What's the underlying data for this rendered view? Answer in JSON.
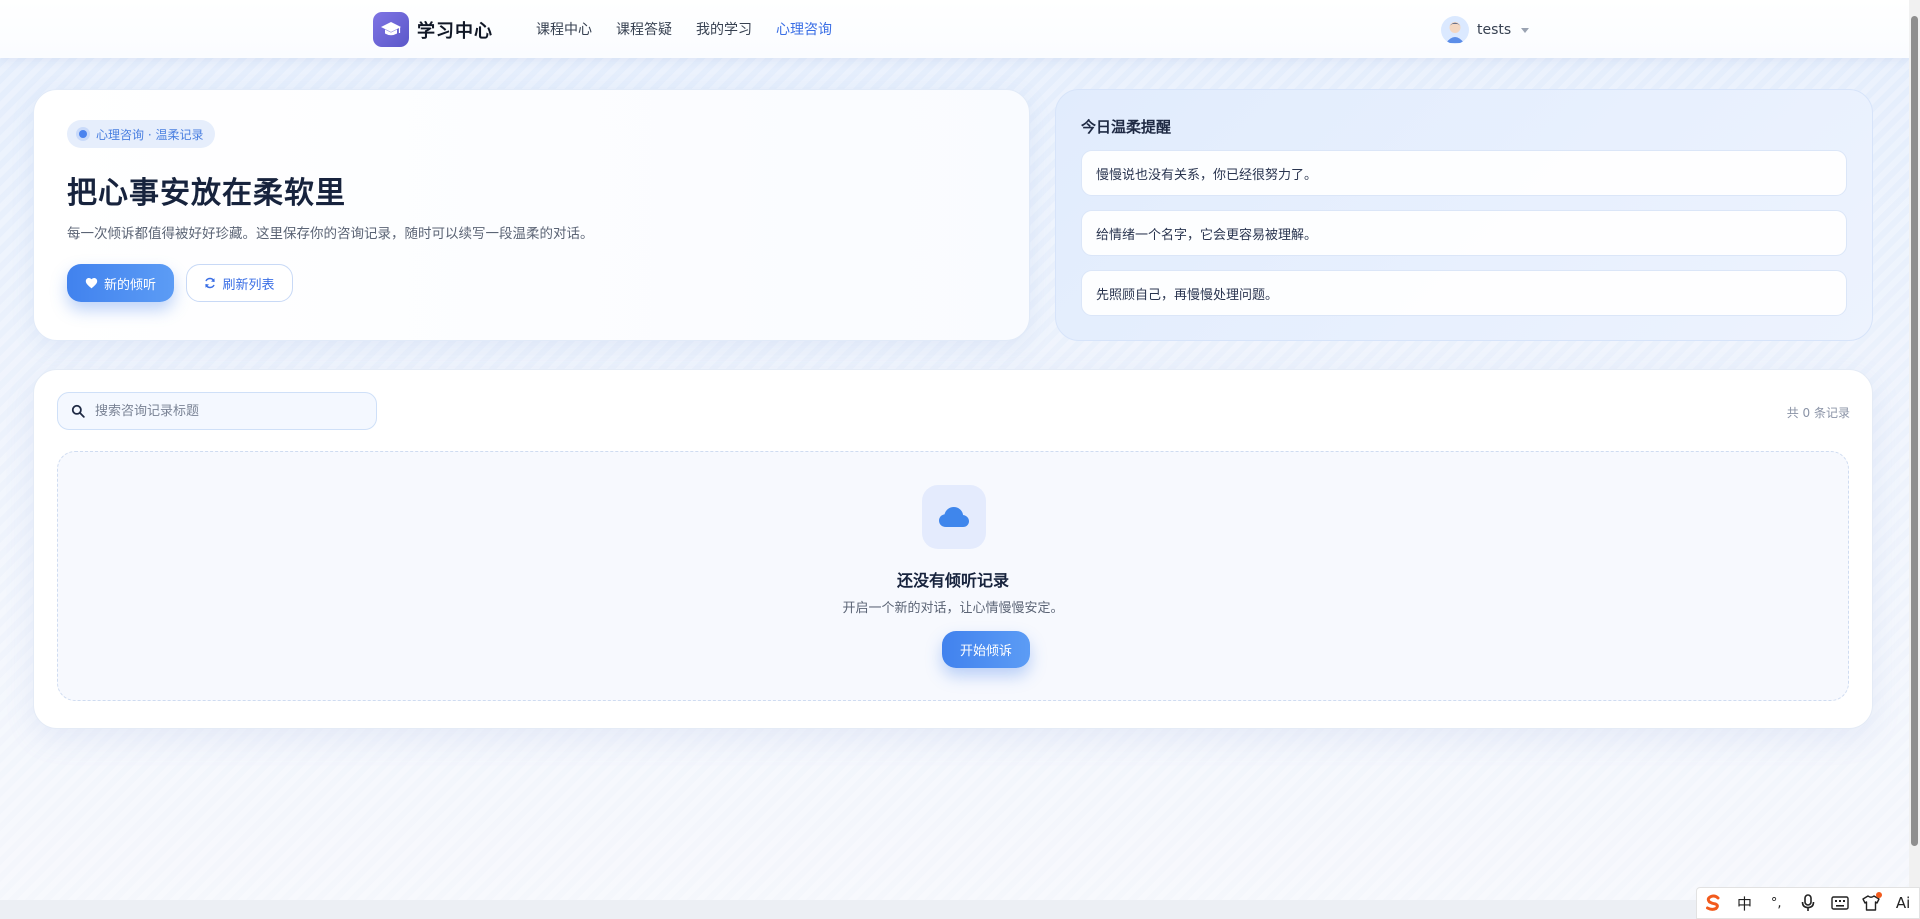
{
  "navbar": {
    "brand": {
      "title": "学习中心",
      "logo_icon": "graduation-cap-icon"
    },
    "links": [
      {
        "label": "课程中心",
        "active": false
      },
      {
        "label": "课程答疑",
        "active": false
      },
      {
        "label": "我的学习",
        "active": false
      },
      {
        "label": "心理咨询",
        "active": true
      }
    ],
    "user": {
      "name": "tests",
      "avatar_icon": "user-avatar-icon",
      "menu_icon": "caret-down-icon"
    }
  },
  "hero": {
    "tag": "心理咨询 · 温柔记录",
    "title": "把心事安放在柔软里",
    "description": "每一次倾诉都值得被好好珍藏。这里保存你的咨询记录，随时可以续写一段温柔的对话。",
    "primary_button": {
      "label": "新的倾听",
      "icon": "heart-icon"
    },
    "secondary_button": {
      "label": "刷新列表",
      "icon": "refresh-icon"
    }
  },
  "reminders": {
    "title": "今日温柔提醒",
    "items": [
      "慢慢说也没有关系，你已经很努力了。",
      "给情绪一个名字，它会更容易被理解。",
      "先照顾自己，再慢慢处理问题。"
    ]
  },
  "records": {
    "search": {
      "placeholder": "搜索咨询记录标题",
      "value": "",
      "icon": "search-icon"
    },
    "count_text": "共 0 条记录",
    "empty": {
      "icon": "cloud-icon",
      "title": "还没有倾听记录",
      "description": "开启一个新的对话，让心情慢慢安定。",
      "button": "开始倾诉"
    }
  },
  "ime_toolbar": {
    "items": [
      {
        "icon": "sogou-logo-icon",
        "label": ""
      },
      {
        "icon": "",
        "label": "中"
      },
      {
        "icon": "punctuation-icon",
        "label": "°,"
      },
      {
        "icon": "microphone-icon",
        "label": ""
      },
      {
        "icon": "keyboard-icon",
        "label": ""
      },
      {
        "icon": "skin-shirt-icon",
        "label": ""
      },
      {
        "icon": "",
        "label": "Ai"
      }
    ]
  },
  "colors": {
    "accent": "#3b6fe5",
    "primary_gradient_start": "#4182ee",
    "primary_gradient_end": "#5c9cf5",
    "brand_purple": "#6a63d6",
    "title_dark": "#17233d"
  }
}
